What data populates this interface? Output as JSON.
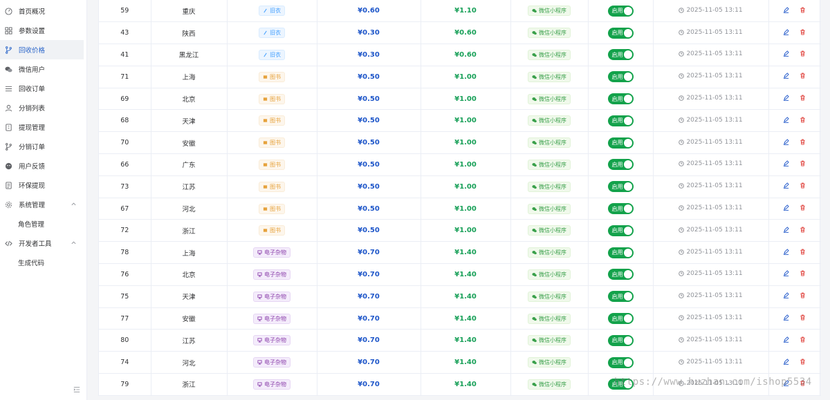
{
  "sidebar": {
    "items": [
      {
        "label": "首页概况",
        "icon": "dashboard-icon"
      },
      {
        "label": "参数设置",
        "icon": "grid-icon"
      },
      {
        "label": "回收价格",
        "icon": "branch-icon",
        "active": true
      },
      {
        "label": "微信用户",
        "icon": "wechat-icon"
      },
      {
        "label": "回收订单",
        "icon": "list-icon"
      },
      {
        "label": "分销列表",
        "icon": "user-icon"
      },
      {
        "label": "提现管理",
        "icon": "wallet-icon"
      },
      {
        "label": "分销订单",
        "icon": "branch-icon"
      },
      {
        "label": "用户反馈",
        "icon": "face-icon"
      },
      {
        "label": "环保提现",
        "icon": "doc-icon"
      },
      {
        "label": "系统管理",
        "icon": "gear-icon",
        "expandable": true
      },
      {
        "label": "角色管理",
        "sub": true
      },
      {
        "label": "开发者工具",
        "icon": "code-icon",
        "expandable": true
      },
      {
        "label": "生成代码",
        "sub": true
      }
    ]
  },
  "table": {
    "rows": [
      {
        "id": "59",
        "region": "重庆",
        "category": "旧衣",
        "cat_type": "old",
        "price1": "¥0.60",
        "price2": "¥1.10",
        "channel": "微信小程序",
        "status": "启用",
        "time": "2025-11-05 13:11"
      },
      {
        "id": "43",
        "region": "陕西",
        "category": "旧衣",
        "cat_type": "old",
        "price1": "¥0.30",
        "price2": "¥0.60",
        "channel": "微信小程序",
        "status": "启用",
        "time": "2025-11-05 13:11"
      },
      {
        "id": "41",
        "region": "黑龙江",
        "category": "旧衣",
        "cat_type": "old",
        "price1": "¥0.30",
        "price2": "¥0.60",
        "channel": "微信小程序",
        "status": "启用",
        "time": "2025-11-05 13:11"
      },
      {
        "id": "71",
        "region": "上海",
        "category": "图书",
        "cat_type": "book",
        "price1": "¥0.50",
        "price2": "¥1.00",
        "channel": "微信小程序",
        "status": "启用",
        "time": "2025-11-05 13:11"
      },
      {
        "id": "69",
        "region": "北京",
        "category": "图书",
        "cat_type": "book",
        "price1": "¥0.50",
        "price2": "¥1.00",
        "channel": "微信小程序",
        "status": "启用",
        "time": "2025-11-05 13:11"
      },
      {
        "id": "68",
        "region": "天津",
        "category": "图书",
        "cat_type": "book",
        "price1": "¥0.50",
        "price2": "¥1.00",
        "channel": "微信小程序",
        "status": "启用",
        "time": "2025-11-05 13:11"
      },
      {
        "id": "70",
        "region": "安徽",
        "category": "图书",
        "cat_type": "book",
        "price1": "¥0.50",
        "price2": "¥1.00",
        "channel": "微信小程序",
        "status": "启用",
        "time": "2025-11-05 13:11"
      },
      {
        "id": "66",
        "region": "广东",
        "category": "图书",
        "cat_type": "book",
        "price1": "¥0.50",
        "price2": "¥1.00",
        "channel": "微信小程序",
        "status": "启用",
        "time": "2025-11-05 13:11"
      },
      {
        "id": "73",
        "region": "江苏",
        "category": "图书",
        "cat_type": "book",
        "price1": "¥0.50",
        "price2": "¥1.00",
        "channel": "微信小程序",
        "status": "启用",
        "time": "2025-11-05 13:11"
      },
      {
        "id": "67",
        "region": "河北",
        "category": "图书",
        "cat_type": "book",
        "price1": "¥0.50",
        "price2": "¥1.00",
        "channel": "微信小程序",
        "status": "启用",
        "time": "2025-11-05 13:11"
      },
      {
        "id": "72",
        "region": "浙江",
        "category": "图书",
        "cat_type": "book",
        "price1": "¥0.50",
        "price2": "¥1.00",
        "channel": "微信小程序",
        "status": "启用",
        "time": "2025-11-05 13:11"
      },
      {
        "id": "78",
        "region": "上海",
        "category": "电子杂物",
        "cat_type": "elec",
        "price1": "¥0.70",
        "price2": "¥1.40",
        "channel": "微信小程序",
        "status": "启用",
        "time": "2025-11-05 13:11"
      },
      {
        "id": "76",
        "region": "北京",
        "category": "电子杂物",
        "cat_type": "elec",
        "price1": "¥0.70",
        "price2": "¥1.40",
        "channel": "微信小程序",
        "status": "启用",
        "time": "2025-11-05 13:11"
      },
      {
        "id": "75",
        "region": "天津",
        "category": "电子杂物",
        "cat_type": "elec",
        "price1": "¥0.70",
        "price2": "¥1.40",
        "channel": "微信小程序",
        "status": "启用",
        "time": "2025-11-05 13:11"
      },
      {
        "id": "77",
        "region": "安徽",
        "category": "电子杂物",
        "cat_type": "elec",
        "price1": "¥0.70",
        "price2": "¥1.40",
        "channel": "微信小程序",
        "status": "启用",
        "time": "2025-11-05 13:11"
      },
      {
        "id": "80",
        "region": "江苏",
        "category": "电子杂物",
        "cat_type": "elec",
        "price1": "¥0.70",
        "price2": "¥1.40",
        "channel": "微信小程序",
        "status": "启用",
        "time": "2025-11-05 13:11"
      },
      {
        "id": "74",
        "region": "河北",
        "category": "电子杂物",
        "cat_type": "elec",
        "price1": "¥0.70",
        "price2": "¥1.40",
        "channel": "微信小程序",
        "status": "启用",
        "time": "2025-11-05 13:11"
      },
      {
        "id": "79",
        "region": "浙江",
        "category": "电子杂物",
        "cat_type": "elec",
        "price1": "¥0.70",
        "price2": "¥1.40",
        "channel": "微信小程序",
        "status": "启用",
        "time": "2025-11-05 13:11"
      }
    ]
  },
  "watermark": "https://www.huzhan.com/ishop5534",
  "colors": {
    "accent": "#2a65c9",
    "switch_on": "#13a24b",
    "price_blue": "#1e56c9",
    "price_green": "#18a058"
  }
}
